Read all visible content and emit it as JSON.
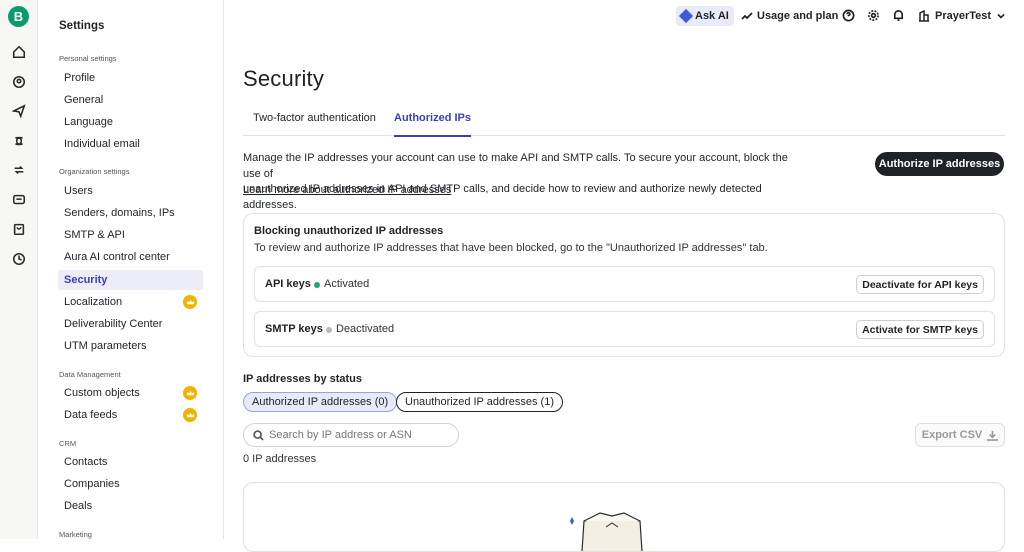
{
  "app": {
    "brand_letter": "B"
  },
  "rail": {
    "icons": [
      "home-icon",
      "contacts-icon",
      "send-icon",
      "automation-icon",
      "conversations-icon",
      "chat-icon",
      "cart-icon",
      "meetings-icon"
    ]
  },
  "sidebar": {
    "title": "Settings",
    "personal_label": "Personal settings",
    "personal": [
      "Profile",
      "General",
      "Language",
      "Individual email"
    ],
    "organization_label": "Organization settings",
    "organization": [
      "Users",
      "Senders, domains, IPs",
      "SMTP & API",
      "Aura AI control center",
      "Security",
      "Localization",
      "Deliverability Center",
      "UTM parameters"
    ],
    "data_label": "Data Management",
    "data": [
      "Custom objects",
      "Data feeds"
    ],
    "crm_label": "CRM",
    "crm": [
      "Contacts",
      "Companies",
      "Deals"
    ],
    "marketing_label": "Marketing"
  },
  "topbar": {
    "ask_ai": "Ask AI",
    "usage": "Usage and plan",
    "account": "PrayerTest"
  },
  "page": {
    "title": "Security",
    "tabs": [
      "Two-factor authentication",
      "Authorized IPs"
    ],
    "description_1": "Manage the IP addresses your account can use to make API and SMTP calls. To secure your account, block the use of",
    "description_2": "unauthorized IP addresses in API and SMTP calls, and decide how to review and authorize newly detected addresses.",
    "learn_more": "Learn more about authorized IP addresses",
    "authorize_button": "Authorize IP addresses"
  },
  "blocking": {
    "title": "Blocking unauthorized IP addresses",
    "description": "To review and authorize IP addresses that have been blocked, go to the \"Unauthorized IP addresses\" tab.",
    "api": {
      "name": "API keys",
      "status": "Activated",
      "button": "Deactivate for API keys",
      "dot_color": "#1fa67a"
    },
    "smtp": {
      "name": "SMTP keys",
      "status": "Deactivated",
      "button": "Activate for SMTP keys",
      "dot_color": "#b9b9b9"
    }
  },
  "ip_status": {
    "heading": "IP addresses by status",
    "pills": [
      "Authorized IP addresses (0)",
      "Unauthorized IP addresses (1)"
    ],
    "search_placeholder": "Search by IP address or ASN",
    "export": "Export CSV",
    "count": "0 IP addresses"
  }
}
